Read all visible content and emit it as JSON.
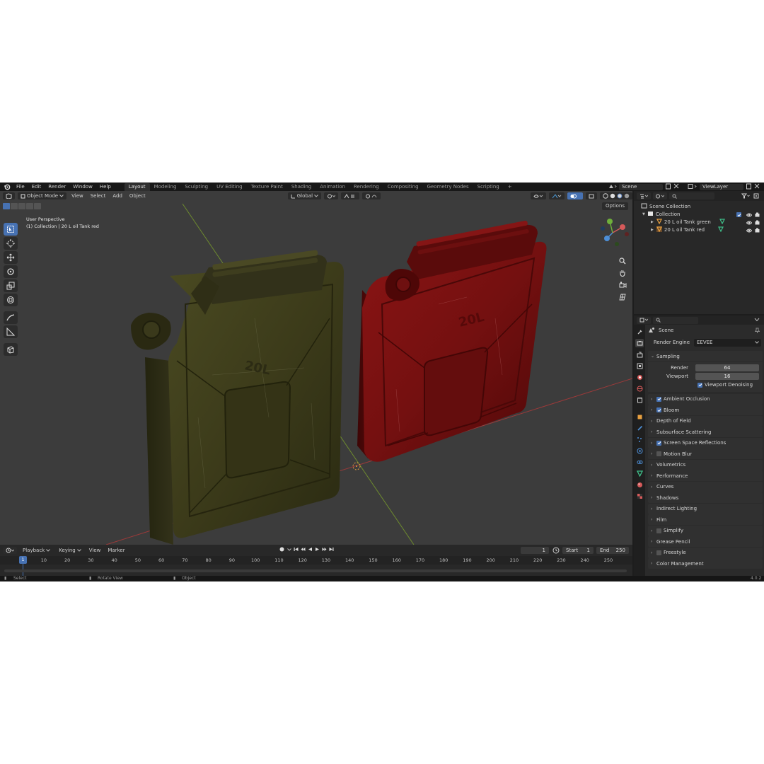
{
  "menu": [
    "File",
    "Edit",
    "Render",
    "Window",
    "Help"
  ],
  "workspaces": [
    "Layout",
    "Modeling",
    "Sculpting",
    "UV Editing",
    "Texture Paint",
    "Shading",
    "Animation",
    "Rendering",
    "Compositing",
    "Geometry Nodes",
    "Scripting",
    "+"
  ],
  "top_right": {
    "scene": "Scene",
    "view_layer": "ViewLayer"
  },
  "viewport": {
    "mode": "Object Mode",
    "menus": [
      "View",
      "Select",
      "Add",
      "Object"
    ],
    "transform_orientation": "Global",
    "options": "Options",
    "view_name": "User Perspective",
    "context": "(1) Collection | 20 L oil Tank red",
    "tanks": [
      {
        "label": "20L",
        "color": "#3f3d1c"
      },
      {
        "label": "20L",
        "color": "#7a1212"
      }
    ]
  },
  "timeline": {
    "menus": [
      "Playback",
      "Keying",
      "View",
      "Marker"
    ],
    "current_frame": "1",
    "start_label": "Start",
    "start": "1",
    "end_label": "End",
    "end": "250",
    "ticks": [
      "1",
      "10",
      "20",
      "30",
      "40",
      "50",
      "60",
      "70",
      "80",
      "90",
      "100",
      "110",
      "120",
      "130",
      "140",
      "150",
      "160",
      "170",
      "180",
      "190",
      "200",
      "210",
      "220",
      "230",
      "240",
      "250"
    ]
  },
  "status": {
    "select": "Select",
    "rotate": "Rotate View",
    "object": "Object",
    "version": "4.0.2"
  },
  "outliner": {
    "scene_collection": "Scene Collection",
    "collection": "Collection",
    "objects": [
      "20 L oil Tank green",
      "20 L oil Tank red"
    ]
  },
  "properties": {
    "scene": "Scene",
    "render_engine_label": "Render Engine",
    "render_engine": "EEVEE",
    "sampling": "Sampling",
    "render_label": "Render",
    "render_value": "64",
    "viewport_label": "Viewport",
    "viewport_value": "16",
    "denoise": "Viewport Denoising",
    "panels": [
      {
        "label": "Ambient Occlusion",
        "checkbox": true,
        "checked": true
      },
      {
        "label": "Bloom",
        "checkbox": true,
        "checked": true
      },
      {
        "label": "Depth of Field",
        "checkbox": false,
        "checked": false
      },
      {
        "label": "Subsurface Scattering",
        "checkbox": false,
        "checked": false
      },
      {
        "label": "Screen Space Reflections",
        "checkbox": true,
        "checked": true
      },
      {
        "label": "Motion Blur",
        "checkbox": true,
        "checked": false
      },
      {
        "label": "Volumetrics",
        "checkbox": false,
        "checked": false
      },
      {
        "label": "Performance",
        "checkbox": false,
        "checked": false
      },
      {
        "label": "Curves",
        "checkbox": false,
        "checked": false
      },
      {
        "label": "Shadows",
        "checkbox": false,
        "checked": false
      },
      {
        "label": "Indirect Lighting",
        "checkbox": false,
        "checked": false
      },
      {
        "label": "Film",
        "checkbox": false,
        "checked": false
      },
      {
        "label": "Simplify",
        "checkbox": true,
        "checked": false
      },
      {
        "label": "Grease Pencil",
        "checkbox": false,
        "checked": false
      },
      {
        "label": "Freestyle",
        "checkbox": true,
        "checked": false
      },
      {
        "label": "Color Management",
        "checkbox": false,
        "checked": false
      }
    ]
  },
  "colors": {
    "accent": "#4772b3",
    "x_axis": "#9b3a3a",
    "y_axis": "#6e8b2f",
    "origin": "#e8a040"
  }
}
